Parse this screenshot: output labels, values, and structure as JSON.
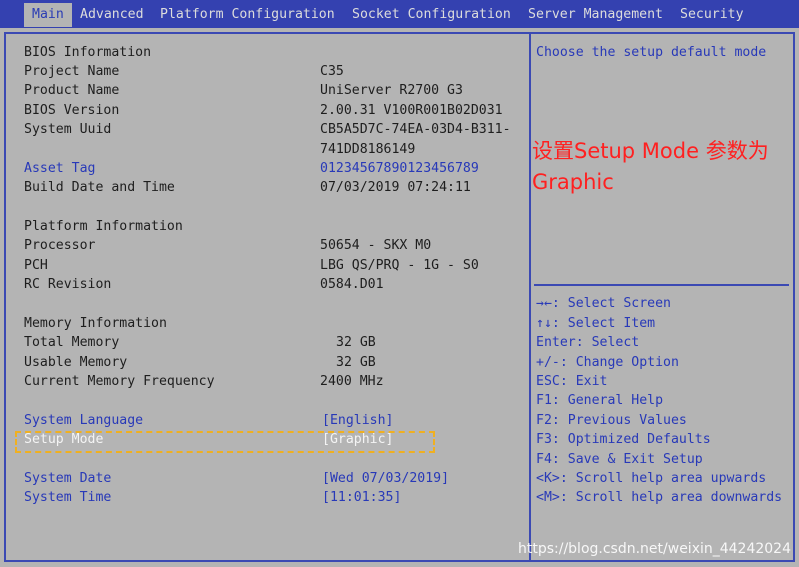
{
  "tabs": [
    {
      "label": "Main",
      "active": true
    },
    {
      "label": "Advanced"
    },
    {
      "label": "Platform Configuration"
    },
    {
      "label": "Socket Configuration"
    },
    {
      "label": "Server Management"
    },
    {
      "label": "Security"
    }
  ],
  "bios_info": {
    "section": "BIOS Information",
    "project_name_label": "Project Name",
    "project_name": "C35",
    "product_name_label": "Product Name",
    "product_name": "UniServer R2700 G3",
    "bios_version_label": "BIOS Version",
    "bios_version": "2.00.31 V100R001B02D031",
    "uuid_label": "System Uuid",
    "uuid_line1": "CB5A5D7C-74EA-03D4-B311-",
    "uuid_line2": "741DD8186149",
    "asset_tag_label": "Asset Tag",
    "asset_tag": "01234567890123456789",
    "build_label": "Build Date and Time",
    "build": "07/03/2019 07:24:11"
  },
  "platform_info": {
    "section": "Platform Information",
    "processor_label": "Processor",
    "processor": "50654 - SKX M0",
    "pch_label": "PCH",
    "pch": "LBG QS/PRQ - 1G - S0",
    "rc_label": "RC Revision",
    "rc": "0584.D01"
  },
  "memory_info": {
    "section": "Memory Information",
    "total_label": "Total Memory",
    "total": "32 GB",
    "usable_label": "Usable Memory",
    "usable": "32 GB",
    "freq_label": "Current Memory Frequency",
    "freq": "2400 MHz"
  },
  "settings": {
    "language_label": "System Language",
    "language": "[English]",
    "setup_mode_label": "Setup Mode",
    "setup_mode": "[Graphic]",
    "date_label": "System Date",
    "date": "[Wed 07/03/2019]",
    "time_label": "System Time",
    "time": "[11:01:35]"
  },
  "help": {
    "description": "Choose the setup default mode",
    "keys": [
      "→←: Select Screen",
      "↑↓: Select Item",
      "Enter: Select",
      "+/-: Change Option",
      "ESC: Exit",
      "F1: General Help",
      "F2: Previous Values",
      "F3: Optimized Defaults",
      "F4: Save & Exit Setup",
      "<K>: Scroll help area upwards",
      "<M>: Scroll help area downwards"
    ]
  },
  "annotation": "设置Setup Mode 参数为Graphic",
  "watermark": "https://blog.csdn.net/weixin_44242024",
  "colors": {
    "accent": "#3441b0",
    "background": "#b4b4b4",
    "highlight": "#f0b020",
    "annotation": "#ff2020"
  }
}
